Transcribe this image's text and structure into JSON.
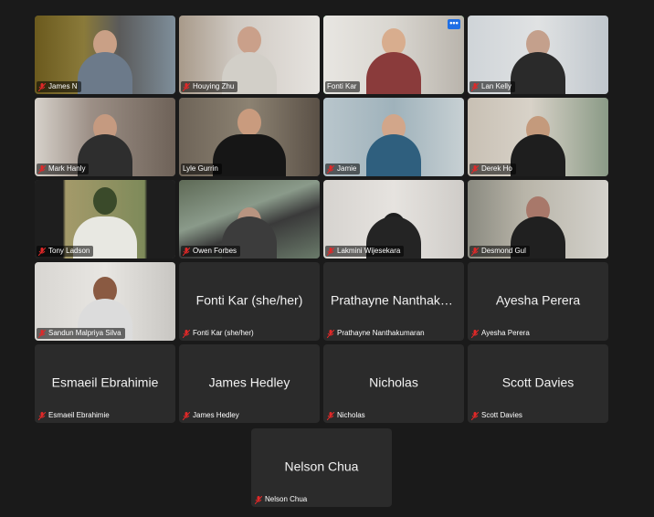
{
  "participants": [
    {
      "name": "James N",
      "display": ""
    },
    {
      "name": "Houying Zhu",
      "display": ""
    },
    {
      "name": "Fonti Kar",
      "display": ""
    },
    {
      "name": "Lan Kelly",
      "display": ""
    },
    {
      "name": "Mark Hanly",
      "display": ""
    },
    {
      "name": "Lyle Gurrin",
      "display": ""
    },
    {
      "name": "Jamie",
      "display": ""
    },
    {
      "name": "Derek Ho",
      "display": ""
    },
    {
      "name": "Tony Ladson",
      "display": ""
    },
    {
      "name": "Owen Forbes",
      "display": ""
    },
    {
      "name": "Lakmini Wijesekara",
      "display": ""
    },
    {
      "name": "Desmond Gul",
      "display": ""
    },
    {
      "name": "Sandun Malpriya Silva",
      "display": ""
    },
    {
      "name": "Fonti Kar (she/her)",
      "display": "Fonti Kar (she/her)"
    },
    {
      "name": "Prathayne Nanthakumaran",
      "display": "Prathayne Nanthaku..."
    },
    {
      "name": "Ayesha Perera",
      "display": "Ayesha Perera"
    },
    {
      "name": "Esmaeil Ebrahimie",
      "display": "Esmaeil Ebrahimie"
    },
    {
      "name": "James Hedley",
      "display": "James Hedley"
    },
    {
      "name": "Nicholas",
      "display": "Nicholas"
    },
    {
      "name": "Scott Davies",
      "display": "Scott Davies"
    },
    {
      "name": "Nelson Chua",
      "display": "Nelson Chua"
    }
  ],
  "more_button": "•••",
  "colors": {
    "active_speaker": "#23d959",
    "muted_icon": "#e02828",
    "accent": "#1f6fe5"
  }
}
